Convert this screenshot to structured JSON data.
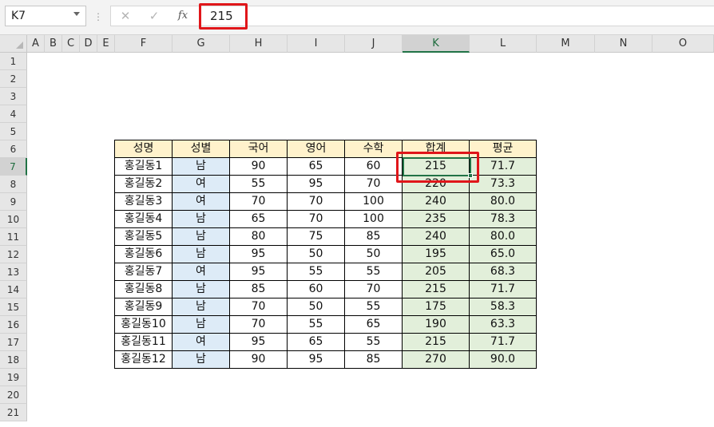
{
  "formula_bar": {
    "name_box": "K7",
    "separator": "⋮",
    "cancel_symbol": "✕",
    "enter_symbol": "✓",
    "function_symbol": "fx",
    "value": "215"
  },
  "columns": [
    "A",
    "B",
    "C",
    "D",
    "E",
    "F",
    "G",
    "H",
    "I",
    "J",
    "K",
    "L",
    "M",
    "N",
    "O"
  ],
  "selected_column": "K",
  "rows": [
    "1",
    "2",
    "3",
    "4",
    "5",
    "6",
    "7",
    "8",
    "9",
    "10",
    "11",
    "12",
    "13",
    "14",
    "15",
    "16",
    "17",
    "18",
    "19",
    "20",
    "21"
  ],
  "selected_row": "7",
  "table": {
    "headers": [
      "성명",
      "성별",
      "국어",
      "영어",
      "수학",
      "합계",
      "평균"
    ],
    "rows": [
      [
        "홍길동1",
        "남",
        "90",
        "65",
        "60",
        "215",
        "71.7"
      ],
      [
        "홍길동2",
        "여",
        "55",
        "95",
        "70",
        "220",
        "73.3"
      ],
      [
        "홍길동3",
        "여",
        "70",
        "70",
        "100",
        "240",
        "80.0"
      ],
      [
        "홍길동4",
        "남",
        "65",
        "70",
        "100",
        "235",
        "78.3"
      ],
      [
        "홍길동5",
        "남",
        "80",
        "75",
        "85",
        "240",
        "80.0"
      ],
      [
        "홍길동6",
        "남",
        "95",
        "50",
        "50",
        "195",
        "65.0"
      ],
      [
        "홍길동7",
        "여",
        "95",
        "55",
        "55",
        "205",
        "68.3"
      ],
      [
        "홍길동8",
        "남",
        "85",
        "60",
        "70",
        "215",
        "71.7"
      ],
      [
        "홍길동9",
        "남",
        "70",
        "50",
        "55",
        "175",
        "58.3"
      ],
      [
        "홍길동10",
        "남",
        "70",
        "55",
        "65",
        "190",
        "63.3"
      ],
      [
        "홍길동11",
        "여",
        "95",
        "65",
        "55",
        "215",
        "71.7"
      ],
      [
        "홍길동12",
        "남",
        "90",
        "95",
        "85",
        "270",
        "90.0"
      ]
    ]
  },
  "colors": {
    "header_fill": "#fff2cc",
    "gender_fill": "#ddebf7",
    "total_fill": "#e2efda",
    "selection": "#217346",
    "highlight": "#e0161a"
  }
}
